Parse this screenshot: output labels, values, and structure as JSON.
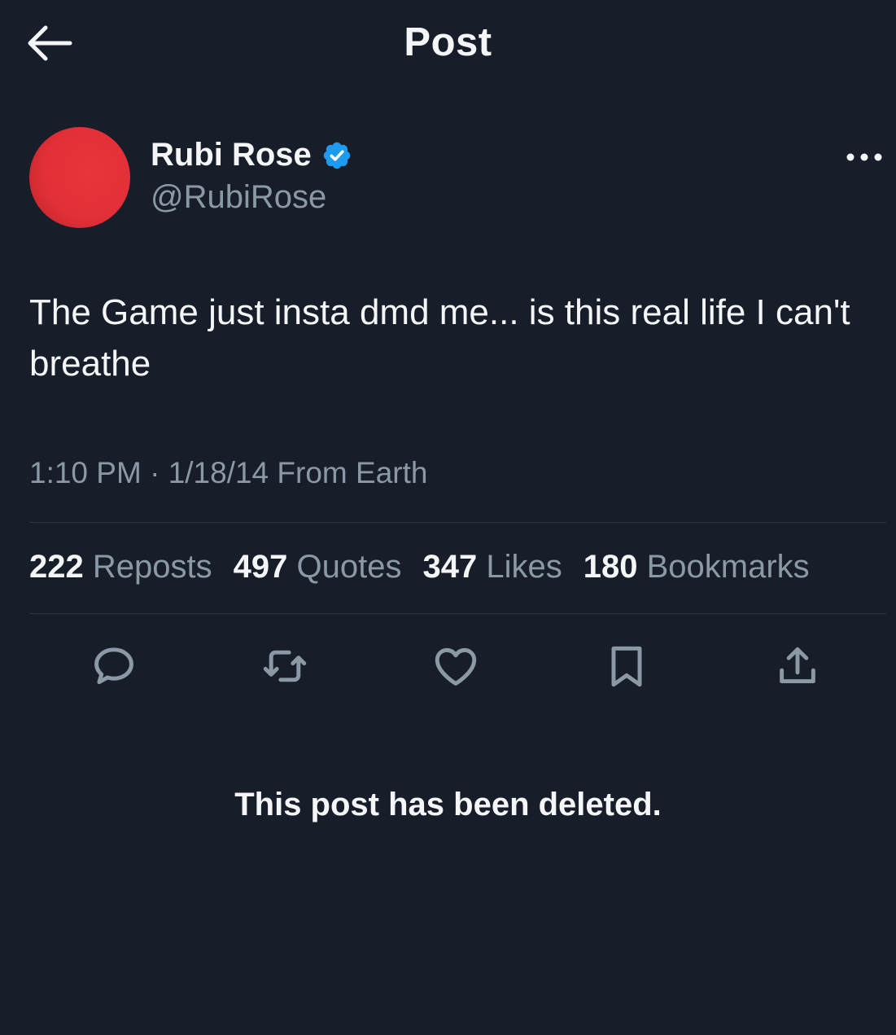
{
  "header": {
    "title": "Post",
    "back_icon": "arrow-left-icon"
  },
  "author": {
    "name": "Rubi Rose",
    "handle": "@RubiRose",
    "verified": true,
    "verified_color": "#1d9bf0",
    "avatar_color": "#e33038"
  },
  "post": {
    "text": "The Game just insta dmd me... is this real life I can't breathe",
    "time": "1:10 PM",
    "separator": "·",
    "date": "1/18/14",
    "source": "From Earth"
  },
  "stats": [
    {
      "count": "222",
      "label": "Reposts"
    },
    {
      "count": "497",
      "label": "Quotes"
    },
    {
      "count": "347",
      "label": "Likes"
    },
    {
      "count": "180",
      "label": "Bookmarks"
    }
  ],
  "actions": [
    {
      "name": "reply",
      "icon": "reply-icon"
    },
    {
      "name": "repost",
      "icon": "repost-icon"
    },
    {
      "name": "like",
      "icon": "heart-icon"
    },
    {
      "name": "bookmark",
      "icon": "bookmark-icon"
    },
    {
      "name": "share",
      "icon": "share-icon"
    }
  ],
  "notice": "This post has been deleted.",
  "colors": {
    "background": "#171e29",
    "text_primary": "#f4f5f6",
    "text_secondary": "#8b98a5",
    "divider": "#2f3640"
  }
}
